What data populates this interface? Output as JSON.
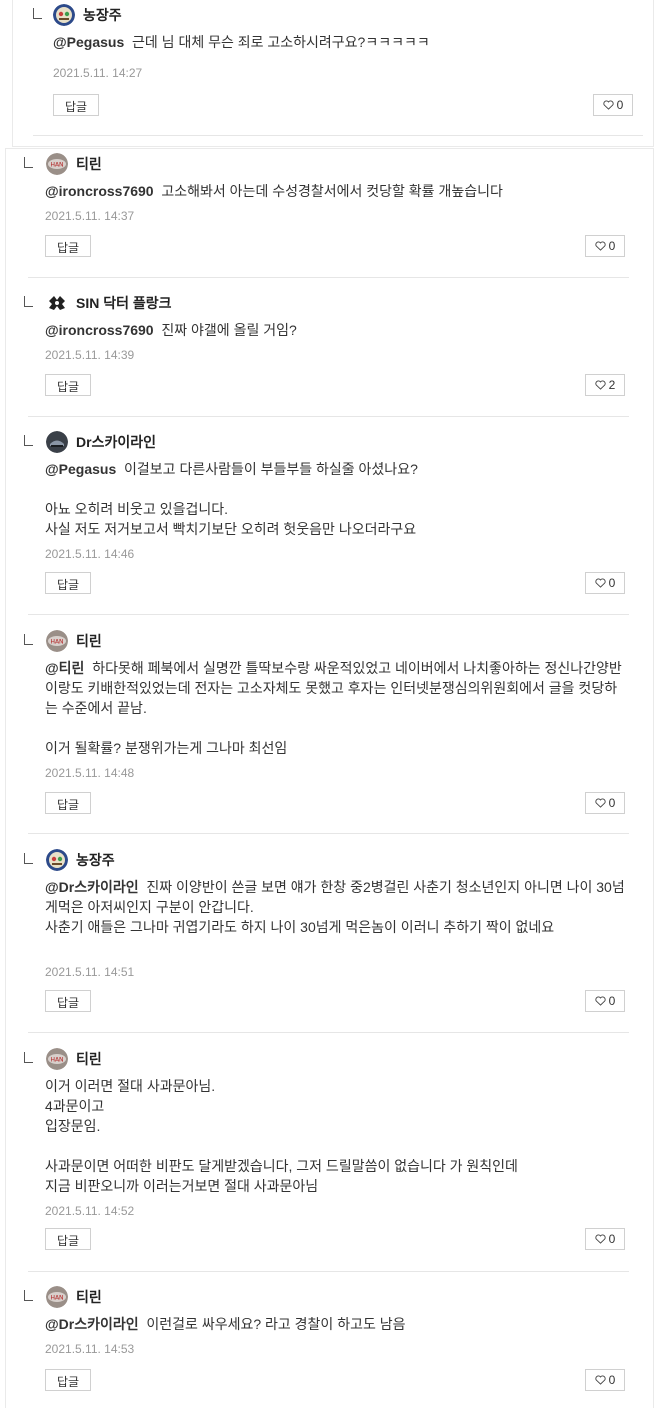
{
  "comments": [
    {
      "author": "농장주",
      "avatar": "farm-avatar",
      "mention": "@Pegasus",
      "lines": [
        "근데 님 대체 무슨 죄로 고소하시려구요?ㅋㅋㅋㅋㅋ"
      ],
      "time": "2021.5.11. 14:27",
      "reply_label": "답글",
      "likes": "0"
    },
    {
      "author": "티린",
      "avatar": "tirin-avatar",
      "mention": "@ironcross7690",
      "lines": [
        "고소해봐서 아는데 수성경찰서에서 컷당할 확률 개높습니다"
      ],
      "time": "2021.5.11. 14:37",
      "reply_label": "답글",
      "likes": "0"
    },
    {
      "author": "SIN 닥터 플랑크",
      "avatar": "sin-avatar",
      "mention": "@ironcross7690",
      "lines": [
        "진짜 야갤에 올릴 거임?"
      ],
      "time": "2021.5.11. 14:39",
      "reply_label": "답글",
      "likes": "2"
    },
    {
      "author": "Dr스카이라인",
      "avatar": "skyline-avatar",
      "mention": "@Pegasus",
      "lines": [
        "이걸보고 다른사람들이 부들부들 하실줄 아셨나요?",
        "",
        "아뇨 오히려 비웃고 있을겁니다.",
        "사실 저도 저거보고서 빡치기보단 오히려 헛웃음만 나오더라구요"
      ],
      "time": "2021.5.11. 14:46",
      "reply_label": "답글",
      "likes": "0"
    },
    {
      "author": "티린",
      "avatar": "tirin-avatar",
      "mention": "@티린",
      "lines": [
        "하다못해 페북에서 실명깐 틀딱보수랑 싸운적있었고 네이버에서 나치좋아하는 정신나간양반이랑도 키배한적있었는데 전자는 고소자체도 못했고 후자는 인터넷분쟁심의위원회에서 글을 컷당하는 수준에서 끝남.",
        "",
        "이거 될확률? 분쟁위가는게 그나마 최선임"
      ],
      "time": "2021.5.11. 14:48",
      "reply_label": "답글",
      "likes": "0"
    },
    {
      "author": "농장주",
      "avatar": "farm-avatar",
      "mention": "@Dr스카이라인",
      "lines": [
        "진짜 이양반이 쓴글 보면 얘가 한창 중2병걸린 사춘기 청소년인지 아니면 나이 30넘게먹은 아저씨인지 구분이 안갑니다.",
        "사춘기 애들은 그나마 귀엽기라도 하지 나이 30넘게 먹은놈이 이러니 추하기 짝이 없네요"
      ],
      "time": "2021.5.11. 14:51",
      "reply_label": "답글",
      "likes": "0"
    },
    {
      "author": "티린",
      "avatar": "tirin-avatar",
      "mention": "",
      "lines": [
        "이거 이러면 절대 사과문아님.",
        "4과문이고",
        "입장문임.",
        "",
        "사과문이면 어떠한 비판도 달게받겠습니다, 그저 드릴말씀이 없습니다 가 원칙인데",
        "지금 비판오니까 이러는거보면 절대 사과문아님"
      ],
      "time": "2021.5.11. 14:52",
      "reply_label": "답글",
      "likes": "0"
    },
    {
      "author": "티린",
      "avatar": "tirin-avatar",
      "mention": "@Dr스카이라인",
      "lines": [
        "이런걸로 싸우세요? 라고 경찰이 하고도 남음"
      ],
      "time": "2021.5.11. 14:53",
      "reply_label": "답글",
      "likes": "0"
    }
  ],
  "colors": {
    "text": "#333333",
    "meta": "#999999",
    "border": "#d0d0d0",
    "divider": "#e6e6e6"
  }
}
